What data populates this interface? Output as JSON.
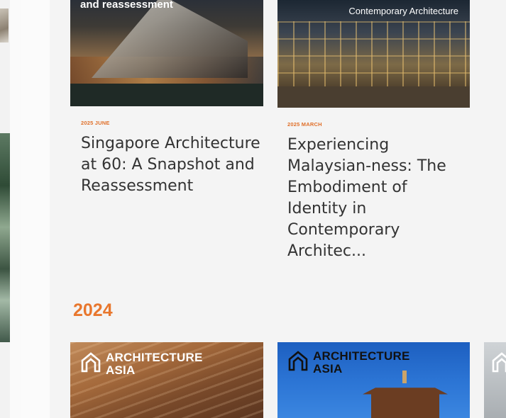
{
  "articles": [
    {
      "image_overlay": "and reassessment",
      "date": "2025 JUNE",
      "title": "Singapore Architecture at 60: A Snapshot and Reassessment"
    },
    {
      "image_overlay": "Contemporary Architecture",
      "date": "2025 MARCH",
      "title": "Experiencing Malaysian-ness: The Embodiment of Identity in Contemporary Architec..."
    }
  ],
  "section_year": "2024",
  "brand": {
    "line1": "ARCHITECTURE",
    "line2": "ASIA"
  },
  "colors": {
    "accent": "#e8772e",
    "title_text": "#333333",
    "background": "#f4f4f4"
  }
}
